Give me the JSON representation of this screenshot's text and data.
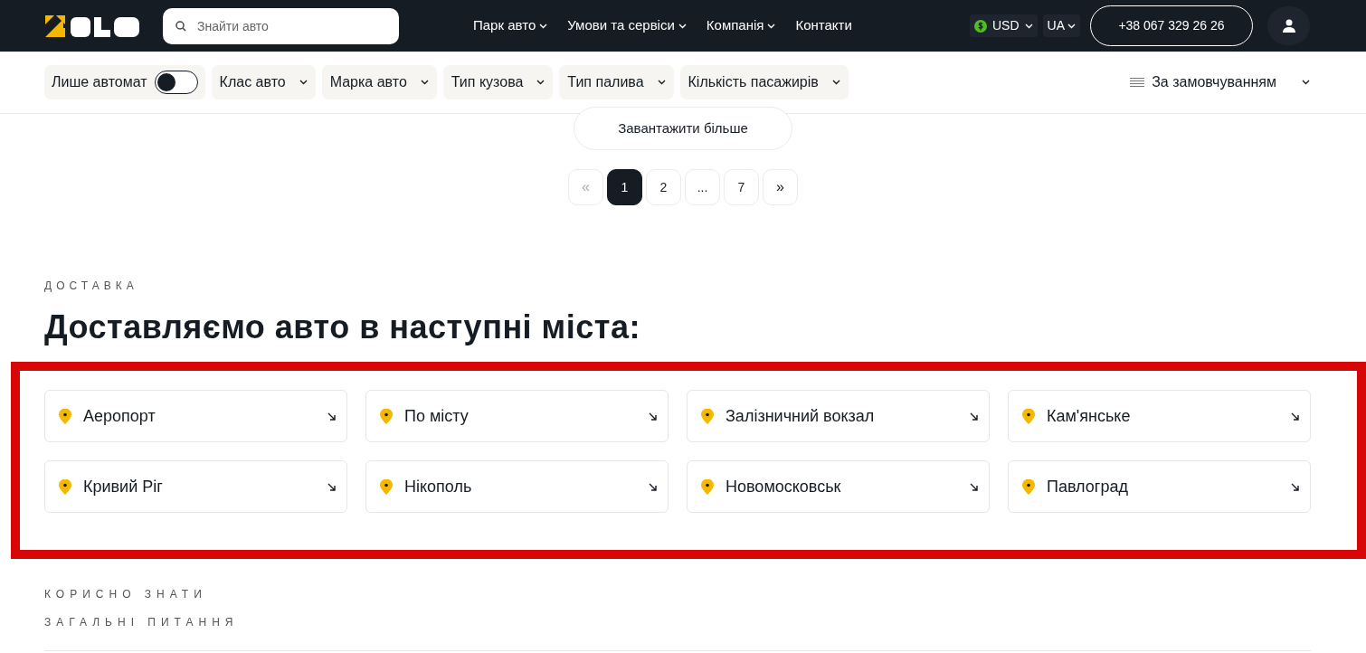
{
  "header": {
    "search": {
      "placeholder": "Знайти авто"
    },
    "nav": [
      {
        "label": "Парк авто",
        "dropdown": true
      },
      {
        "label": "Умови та сервіси",
        "dropdown": true
      },
      {
        "label": "Компанія",
        "dropdown": true
      },
      {
        "label": "Контакти",
        "dropdown": false
      }
    ],
    "currency": "USD",
    "language": "UA",
    "phone": "+38 067 329 26 26"
  },
  "filters": {
    "automatic": {
      "label": "Лише автомат",
      "checked": false
    },
    "dropdowns": [
      "Клас авто",
      "Марка авто",
      "Тип кузова",
      "Тип палива",
      "Кількість пасажирів"
    ],
    "sort": "За замовчуванням"
  },
  "load_more": "Завантажити більше",
  "pagination": [
    {
      "label": "«",
      "kind": "arrow",
      "selected": false,
      "disabled": true
    },
    {
      "label": "1",
      "kind": "page",
      "selected": true,
      "disabled": false
    },
    {
      "label": "2",
      "kind": "page",
      "selected": false,
      "disabled": false
    },
    {
      "label": "...",
      "kind": "page",
      "selected": false,
      "disabled": false
    },
    {
      "label": "7",
      "kind": "page",
      "selected": false,
      "disabled": false
    },
    {
      "label": "»",
      "kind": "arrow",
      "selected": false,
      "disabled": false
    }
  ],
  "delivery": {
    "eyebrow": "ДОСТАВКА",
    "title": "Доставляємо авто в наступні міста:",
    "cities": [
      "Аеропорт",
      "По місту",
      "Залізничний вокзал",
      "Кам'янське",
      "Кривий Ріг",
      "Нікополь",
      "Новомосковськ",
      "Павлоград"
    ]
  },
  "faq": {
    "eyebrow": "КОРИСНО ЗНАТИ",
    "subtitle": "ЗАГАЛЬНІ ПИТАННЯ"
  }
}
